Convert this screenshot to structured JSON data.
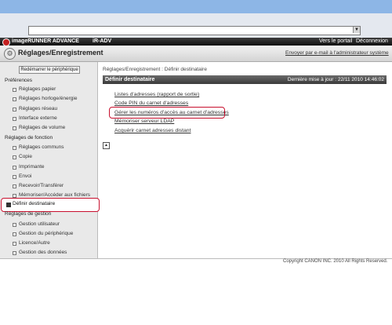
{
  "header": {
    "brand": "imageRUNNER ADVANCE",
    "model": "iR-ADV",
    "portal_link": "Vers le portail",
    "logout_link": "Déconnexion",
    "page_title": "Réglages/Enregistrement",
    "email_link": "Envoyer par e-mail à l'administrateur système"
  },
  "sidebar": {
    "restart_button": "Redémarrer le périphérique",
    "groups": [
      {
        "heading": "Préférences",
        "items": [
          "Réglages papier",
          "Réglages horloge/énergie",
          "Réglages réseau",
          "Interface externe",
          "Réglages de volume"
        ]
      },
      {
        "heading": "Réglages de fonction",
        "items": [
          "Réglages communs",
          "Copie",
          "Imprimante",
          "Envoi",
          "Recevoir/Transférer",
          "Mémoriser/Accéder aux fichiers"
        ]
      },
      {
        "heading": "Définir destinataire",
        "items": []
      },
      {
        "heading": "Réglages de gestion",
        "items": [
          "Gestion utilisateur",
          "Gestion du périphérique",
          "Licence/Autre",
          "Gestion des données"
        ]
      }
    ]
  },
  "main": {
    "breadcrumb": "Réglages/Enregistrement : Définir destinataire",
    "section_title": "Définir destinataire",
    "last_update": "Dernière mise à jour : 22/11 2010 14:46:02",
    "links": [
      "Listes d'adresses (rapport de sortie)",
      "Code PIN du carnet d'adresses",
      "Gérer les numéros d'accès au carnet d'adresses",
      "Mémoriser serveur LDAP",
      "Acquérir carnet adresses distant"
    ]
  },
  "footer": {
    "copyright": "Copyright CANON INC. 2010 All Rights Reserved."
  },
  "colors": {
    "highlight": "#c8102e",
    "accent_bar": "#8db6e6"
  },
  "icons": [
    "logo-icon",
    "settings-icon",
    "back-to-top-icon",
    "dropdown-arrow-icon"
  ]
}
